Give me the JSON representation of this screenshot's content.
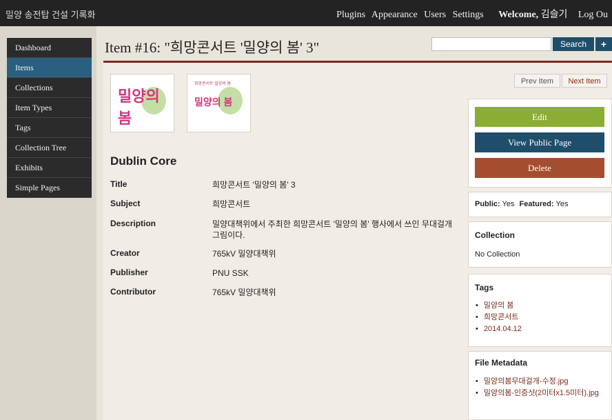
{
  "app": {
    "site_title": "밀양 송전탑 건설 기록화"
  },
  "topnav": {
    "plugins": "Plugins",
    "appearance": "Appearance",
    "users": "Users",
    "settings": "Settings",
    "welcome": "Welcome,",
    "username": "김슬기",
    "logout": "Log Ou"
  },
  "sidebar": {
    "items": [
      {
        "label": "Dashboard"
      },
      {
        "label": "Items"
      },
      {
        "label": "Collections"
      },
      {
        "label": "Item Types"
      },
      {
        "label": "Tags"
      },
      {
        "label": "Collection Tree"
      },
      {
        "label": "Exhibits"
      },
      {
        "label": "Simple Pages"
      }
    ]
  },
  "page": {
    "title": "Item #16: \"희망콘서트 '밀양의 봄' 3\""
  },
  "search": {
    "button_label": "Search",
    "plus_label": "+"
  },
  "thumbnails": {
    "t1_title": "밀양의 봄",
    "t2_title": "희망콘서트",
    "t2_top": "희망콘서트 밀양의 봄"
  },
  "metadata": {
    "section_title": "Dublin Core",
    "rows": [
      {
        "label": "Title",
        "value": "희망콘서트 '밀양의 봄' 3"
      },
      {
        "label": "Subject",
        "value": "희망콘서트"
      },
      {
        "label": "Description",
        "value": "밀양대책위에서 주최한 희망콘서트 '밀양의 봄' 행사에서 쓰인 무대걸개 그림이다."
      },
      {
        "label": "Creator",
        "value": "765kV 밀양대책위"
      },
      {
        "label": "Publisher",
        "value": "PNU SSK"
      },
      {
        "label": "Contributor",
        "value": "765kV 밀양대책위"
      }
    ]
  },
  "item_nav": {
    "prev": "Prev Item",
    "next": "Next Item"
  },
  "actions": {
    "edit": "Edit",
    "view_public": "View Public Page",
    "delete": "Delete"
  },
  "status": {
    "public_label": "Public:",
    "public_value": "Yes",
    "featured_label": "Featured:",
    "featured_value": "Yes"
  },
  "collection": {
    "heading": "Collection",
    "value": "No Collection"
  },
  "tags": {
    "heading": "Tags",
    "items": [
      "밀양의 봄",
      "희망콘서트",
      "2014.04.12"
    ]
  },
  "file_metadata": {
    "heading": "File Metadata",
    "items": [
      "밀양의봄무대걸개-수정.jpg",
      "밀양의봄-인증샷(2미터x1.5미터).jpg"
    ]
  }
}
